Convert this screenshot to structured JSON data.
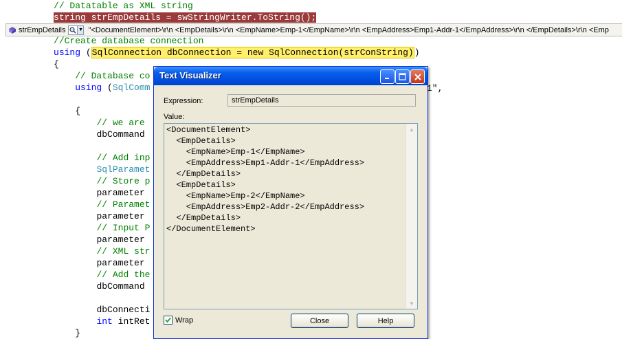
{
  "editor": {
    "lines": [
      {
        "indent": "          ",
        "segments": [
          {
            "cls": "cm",
            "text": "// Datatable as XML string"
          }
        ]
      },
      {
        "indent": "          ",
        "segments": [
          {
            "cls": "bp",
            "text": "string strEmpDetails = swStringWriter.ToString();"
          }
        ]
      },
      {
        "indent": "",
        "segments": []
      },
      {
        "indent": "          ",
        "segments": [
          {
            "cls": "cm",
            "text": "//Create database connection"
          }
        ]
      },
      {
        "indent": "          ",
        "segments": [
          {
            "cls": "kw",
            "text": "using"
          },
          {
            "cls": "",
            "text": " ("
          },
          {
            "cls": "hl",
            "text": "SqlConnection dbConnection = new SqlConnection(strConString)"
          },
          {
            "cls": "",
            "text": ")"
          }
        ]
      },
      {
        "indent": "          ",
        "segments": [
          {
            "cls": "",
            "text": "{"
          }
        ]
      },
      {
        "indent": "              ",
        "segments": [
          {
            "cls": "cm",
            "text": "// Database co"
          }
        ]
      },
      {
        "indent": "              ",
        "segments": [
          {
            "cls": "kw",
            "text": "using"
          },
          {
            "cls": "",
            "text": " ("
          },
          {
            "cls": "ty",
            "text": "SqlComm"
          }
        ]
      },
      {
        "indent": "",
        "segments": []
      },
      {
        "indent": "              ",
        "segments": [
          {
            "cls": "",
            "text": "{"
          }
        ]
      },
      {
        "indent": "                  ",
        "segments": [
          {
            "cls": "cm",
            "text": "// we are"
          }
        ]
      },
      {
        "indent": "                  ",
        "segments": [
          {
            "cls": "",
            "text": "dbCommand"
          }
        ]
      },
      {
        "indent": "",
        "segments": []
      },
      {
        "indent": "                  ",
        "segments": [
          {
            "cls": "cm",
            "text": "// Add inp"
          }
        ]
      },
      {
        "indent": "                  ",
        "segments": [
          {
            "cls": "ty",
            "text": "SqlParamet"
          }
        ]
      },
      {
        "indent": "                  ",
        "segments": [
          {
            "cls": "cm",
            "text": "// Store p"
          }
        ]
      },
      {
        "indent": "                  ",
        "segments": [
          {
            "cls": "",
            "text": "parameter"
          }
        ]
      },
      {
        "indent": "                  ",
        "segments": [
          {
            "cls": "cm",
            "text": "// Paramet"
          }
        ]
      },
      {
        "indent": "                  ",
        "segments": [
          {
            "cls": "",
            "text": "parameter"
          }
        ]
      },
      {
        "indent": "                  ",
        "segments": [
          {
            "cls": "cm",
            "text": "// Input P"
          }
        ]
      },
      {
        "indent": "                  ",
        "segments": [
          {
            "cls": "",
            "text": "parameter"
          }
        ]
      },
      {
        "indent": "                  ",
        "segments": [
          {
            "cls": "cm",
            "text": "// XML str"
          }
        ]
      },
      {
        "indent": "                  ",
        "segments": [
          {
            "cls": "",
            "text": "parameter"
          }
        ]
      },
      {
        "indent": "                  ",
        "segments": [
          {
            "cls": "cm",
            "text": "// Add the"
          }
        ]
      },
      {
        "indent": "                  ",
        "segments": [
          {
            "cls": "",
            "text": "dbCommand"
          }
        ]
      },
      {
        "indent": "",
        "segments": []
      },
      {
        "indent": "                  ",
        "segments": [
          {
            "cls": "",
            "text": "dbConnecti"
          }
        ]
      },
      {
        "indent": "                  ",
        "segments": [
          {
            "cls": "kw",
            "text": "int"
          },
          {
            "cls": "",
            "text": " intRet"
          }
        ]
      },
      {
        "indent": "              ",
        "segments": [
          {
            "cls": "",
            "text": "}"
          }
        ]
      }
    ],
    "partial_right_text": "1\","
  },
  "datatip": {
    "name": "strEmpDetails",
    "value": "\"<DocumentElement>\\r\\n  <EmpDetails>\\r\\n    <EmpName>Emp-1</EmpName>\\r\\n    <EmpAddress>Emp1-Addr-1</EmpAddress>\\r\\n  </EmpDetails>\\r\\n  <Emp"
  },
  "dialog": {
    "title": "Text Visualizer",
    "expression_label": "Expression:",
    "expression_value": "strEmpDetails",
    "value_label": "Value:",
    "value_text": "<DocumentElement>\n  <EmpDetails>\n    <EmpName>Emp-1</EmpName>\n    <EmpAddress>Emp1-Addr-1</EmpAddress>\n  </EmpDetails>\n  <EmpDetails>\n    <EmpName>Emp-2</EmpName>\n    <EmpAddress>Emp2-Addr-2</EmpAddress>\n  </EmpDetails>\n</DocumentElement>",
    "wrap_label": "Wrap",
    "wrap_checked": true,
    "close_label": "Close",
    "help_label": "Help"
  }
}
